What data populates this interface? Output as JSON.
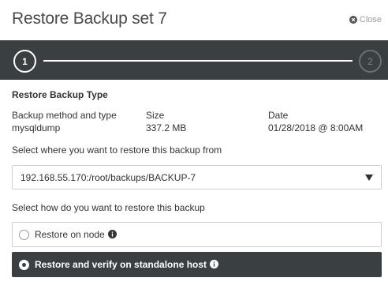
{
  "dialog": {
    "title": "Restore Backup set 7",
    "close_label": "Close"
  },
  "stepper": {
    "steps": [
      {
        "number": "1",
        "state": "active"
      },
      {
        "number": "2",
        "state": "inactive"
      }
    ]
  },
  "section": {
    "title": "Restore Backup Type",
    "columns": [
      {
        "label": "Backup method and type",
        "value": "mysqldump"
      },
      {
        "label": "Size",
        "value": "337.2 MB"
      },
      {
        "label": "Date",
        "value": "01/28/2018 @ 8:00AM"
      }
    ]
  },
  "source": {
    "instruction": "Select where you want to restore this backup from",
    "selected": "192.168.55.170:/root/backups/BACKUP-7"
  },
  "method": {
    "instruction": "Select how do you want to restore this backup",
    "options": [
      {
        "label": "Restore on node",
        "selected": false
      },
      {
        "label": "Restore and verify on standalone host",
        "selected": true
      }
    ]
  },
  "colors": {
    "dark_bar": "#3a3f42",
    "border": "#cfcfcf"
  },
  "icons": {
    "close": "close-circle-icon",
    "caret": "caret-down-icon",
    "info": "info-circle-icon"
  }
}
